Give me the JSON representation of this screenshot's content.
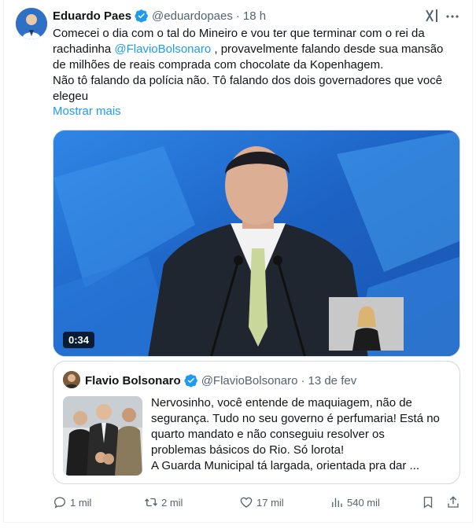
{
  "author": {
    "name": "Eduardo Paes",
    "handle": "@eduardopaes",
    "time": "18 h"
  },
  "tweet": {
    "lines": [
      "Comecei o dia com o tal do Mineiro e vou ter que terminar com o rei da",
      "rachadinha",
      "@FlavioBolsonaro",
      " , provavelmente falando desde sua mansão",
      "de milhões de reais comprada com chocolate da Kopenhagem.",
      "Não tô falando da polícia não.  Tô falando dos dois governadores que você",
      "elegeu"
    ],
    "show_more": "Mostrar mais"
  },
  "video": {
    "duration": "0:34"
  },
  "quote": {
    "name": "Flavio Bolsonaro",
    "handle": "@FlavioBolsonaro",
    "date": "13 de fev",
    "lines": [
      "Nervosinho, você entende de maquiagem, não de",
      "segurança. Tudo no seu governo é perfumaria! Está no",
      "quarto mandato e não conseguiu resolver os",
      "problemas básicos do Rio. Só lorota!",
      "A Guarda Municipal tá largada, orientada pra dar ..."
    ]
  },
  "actions": {
    "replies": "1 mil",
    "reposts": "2 mil",
    "likes": "17 mil",
    "views": "540 mil"
  },
  "colors": {
    "accent": "#1d9bf0",
    "muted": "#536471",
    "border": "#cfd9de"
  },
  "icons": [
    "verified-badge-icon",
    "grok-icon",
    "more-icon",
    "reply-icon",
    "repost-icon",
    "like-icon",
    "views-icon",
    "bookmark-icon",
    "share-icon"
  ]
}
